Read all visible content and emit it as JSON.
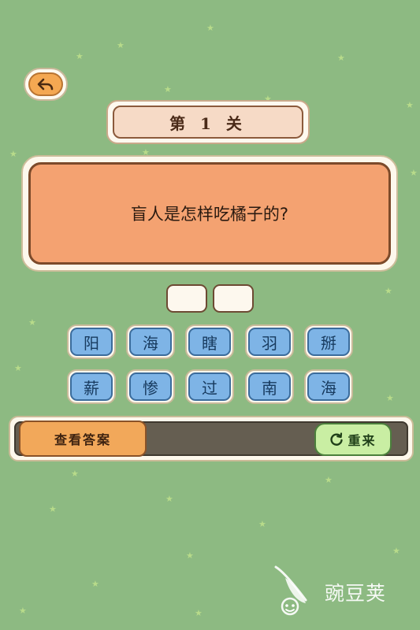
{
  "level": {
    "label": "第 1 关"
  },
  "question": {
    "text": "盲人是怎样吃橘子的?"
  },
  "answer_slots": [
    "",
    ""
  ],
  "letter_tiles": [
    [
      "阳",
      "海",
      "瞎",
      "羽",
      "掰"
    ],
    [
      "薪",
      "惨",
      "过",
      "南",
      "海"
    ]
  ],
  "actions": {
    "show_answer": "查看答案",
    "restart": "重来"
  },
  "watermark": {
    "text": "豌豆荚"
  },
  "icons": {
    "back": "back-arrow-icon",
    "restart": "refresh-icon",
    "logo": "pea-pod-icon"
  },
  "colors": {
    "background": "#8dba82",
    "question_card": "#f4a271",
    "tile": "#7eb4e6",
    "answer_button": "#f2a85a",
    "restart_button": "#c9eea3"
  }
}
